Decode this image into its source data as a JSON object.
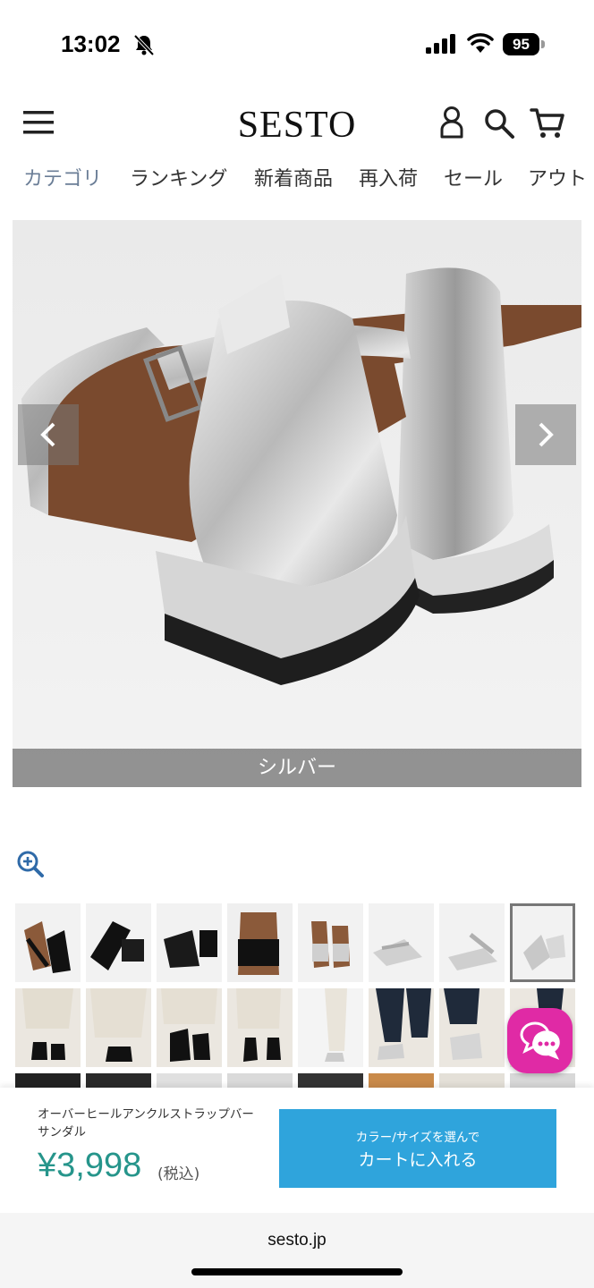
{
  "status": {
    "time": "13:02",
    "battery": "95"
  },
  "header": {
    "brand": "SESTO"
  },
  "nav": {
    "items": [
      {
        "label": "カテゴリ"
      },
      {
        "label": "ランキング"
      },
      {
        "label": "新着商品"
      },
      {
        "label": "再入荷"
      },
      {
        "label": "セール"
      },
      {
        "label": "アウト"
      }
    ]
  },
  "gallery": {
    "caption": "シルバー"
  },
  "product": {
    "name": "オーバーヒールアンクルストラップバーサンダル",
    "price": "¥3,998",
    "tax_note": "(税込)"
  },
  "cart_button": {
    "sub_label": "カラー/サイズを選んで",
    "main_label": "カートに入れる"
  },
  "browser": {
    "url": "sesto.jp"
  },
  "colors": {
    "accent_blue": "#2fa4dc",
    "price_green": "#26958b",
    "chat_pink": "#e02aa5",
    "nav_active": "#6a7d96"
  },
  "icons": [
    "menu-icon",
    "user-icon",
    "search-icon",
    "cart-icon",
    "chevron-left-icon",
    "chevron-right-icon",
    "zoom-in-icon",
    "chat-icon"
  ]
}
